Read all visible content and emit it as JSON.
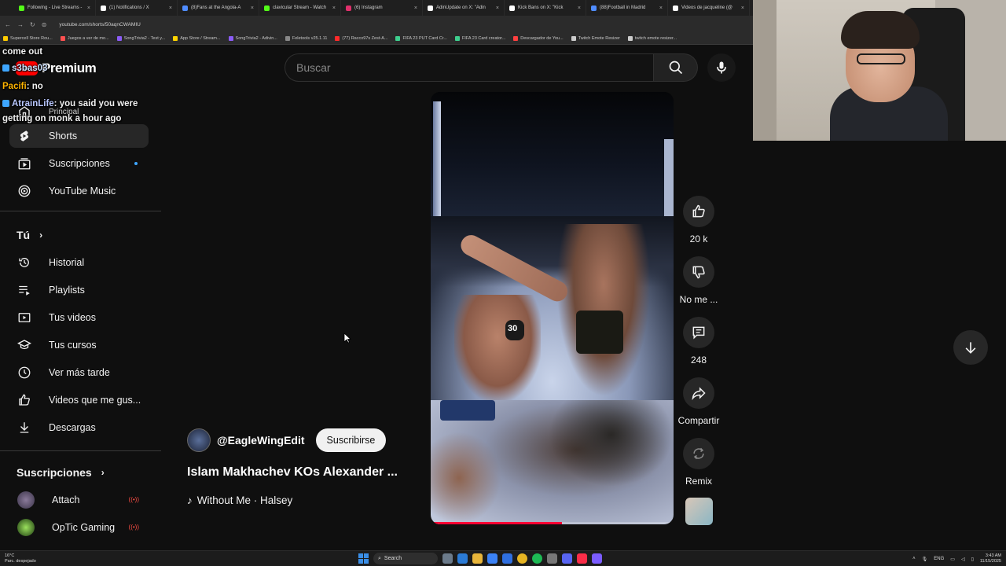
{
  "browser": {
    "tabs": [
      {
        "label": "Following - Live Streams -",
        "color": "#53fc18"
      },
      {
        "label": "(1) Notifications / X",
        "color": "#ffffff"
      },
      {
        "label": "(8)Fans at the Angola-A",
        "color": "#4f8cff"
      },
      {
        "label": "clavicular Stream - Watch",
        "color": "#53fc18"
      },
      {
        "label": "(6) Instagram",
        "color": "#e1306c"
      },
      {
        "label": "AdinUpdate on X: \"Adin",
        "color": "#ffffff"
      },
      {
        "label": "Kick Bans on X: \"Kick",
        "color": "#ffffff"
      },
      {
        "label": "(88)Football in Madrid",
        "color": "#4f8cff"
      },
      {
        "label": "Videos de jacqueline (@",
        "color": "#ffffff"
      }
    ],
    "url": "youtube.com/shorts/50aqnCWAMIU",
    "bookmarks": [
      {
        "label": "Supercell Store Rou...",
        "color": "#ffcc00"
      },
      {
        "label": "Juegos a ver de mo...",
        "color": "#ff5050"
      },
      {
        "label": "SongTrivia2 - Test y...",
        "color": "#8b5cf6"
      },
      {
        "label": "App Store / Stream...",
        "color": "#ffd400"
      },
      {
        "label": "SongTrivia2 - Adivin...",
        "color": "#8b5cf6"
      },
      {
        "label": "Feletools v25.1.11",
        "color": "#888888"
      },
      {
        "label": "(77) Racco97s Zest-A...",
        "color": "#ff2a2a"
      },
      {
        "label": "FIFA 23 PUT Card Cr...",
        "color": "#3ecf8e"
      },
      {
        "label": "FIFA 23 Card creator...",
        "color": "#3ecf8e"
      },
      {
        "label": "Descargador de You...",
        "color": "#ff4040"
      },
      {
        "label": "Twitch Emote Resizer",
        "color": "#cccccc"
      },
      {
        "label": "twitch emote resizer...",
        "color": "#cccccc"
      }
    ]
  },
  "youtube": {
    "brand_suffix": "Premium",
    "search_placeholder": "Buscar",
    "nav": {
      "principal": "Principal",
      "shorts": "Shorts",
      "subscriptions": "Suscripciones",
      "music": "YouTube Music"
    },
    "you_section": {
      "heading": "Tú",
      "items": {
        "history": "Historial",
        "playlists": "Playlists",
        "your_videos": "Tus videos",
        "courses": "Tus cursos",
        "watch_later": "Ver más tarde",
        "liked": "Videos que me gus...",
        "downloads": "Descargas"
      }
    },
    "subs_section": {
      "heading": "Suscripciones",
      "channels": [
        {
          "name": "Attach"
        },
        {
          "name": "OpTic Gaming"
        }
      ]
    },
    "short": {
      "channel": "@EagleWingEdit",
      "subscribe": "Suscribirse",
      "title": "Islam Makhachev KOs Alexander ...",
      "music": "Without Me · Halsey",
      "glove_number": "30",
      "progress": 0.54
    },
    "actions": {
      "likes": "20 k",
      "dislike": "No me ...",
      "comments": "248",
      "share": "Compartir",
      "remix": "Remix"
    }
  },
  "chat": [
    {
      "text": "come out",
      "user": "",
      "user_color": "#ffffff"
    },
    {
      "text": "",
      "user": "s3bas03",
      "user_color": "#cfe3ff"
    },
    {
      "text": ": no",
      "user": "Pacifi",
      "user_color": "#ffb400"
    },
    {
      "text": ": you said you were",
      "user": "AtrainLife",
      "user_color": "#b9c7ff"
    },
    {
      "text": "getting on monk a hour ago",
      "user": "",
      "user_color": "#ffffff"
    }
  ],
  "taskbar": {
    "weather_temp": "16°C",
    "weather_desc": "Parc. despejado",
    "search": "Search",
    "lang": "ENG",
    "time": "3:43 AM",
    "date": "11/15/2025"
  }
}
